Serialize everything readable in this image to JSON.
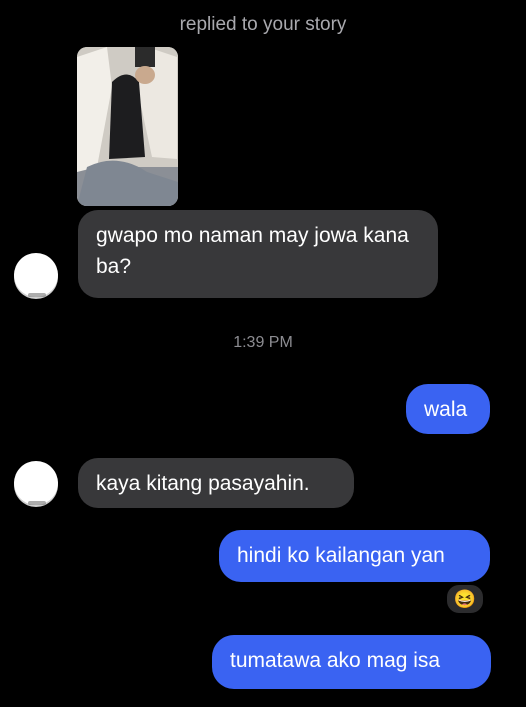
{
  "header": {
    "story_reply_note": "replied to your story"
  },
  "messages": [
    {
      "from": "them",
      "text": "gwapo mo naman may jowa kana ba?"
    },
    {
      "from": "me",
      "text": "wala"
    },
    {
      "from": "them",
      "text": "kaya kitang pasayahin."
    },
    {
      "from": "me",
      "text": "hindi ko kailangan yan",
      "reaction": "😆"
    },
    {
      "from": "me",
      "text": "tumatawa ako mag isa"
    }
  ],
  "timestamp": "1:39 PM",
  "colors": {
    "background": "#000000",
    "incoming_bubble": "#38383a",
    "outgoing_bubble": "#3a63f2"
  },
  "icons": {
    "reaction": "laughing-emoji-icon"
  }
}
